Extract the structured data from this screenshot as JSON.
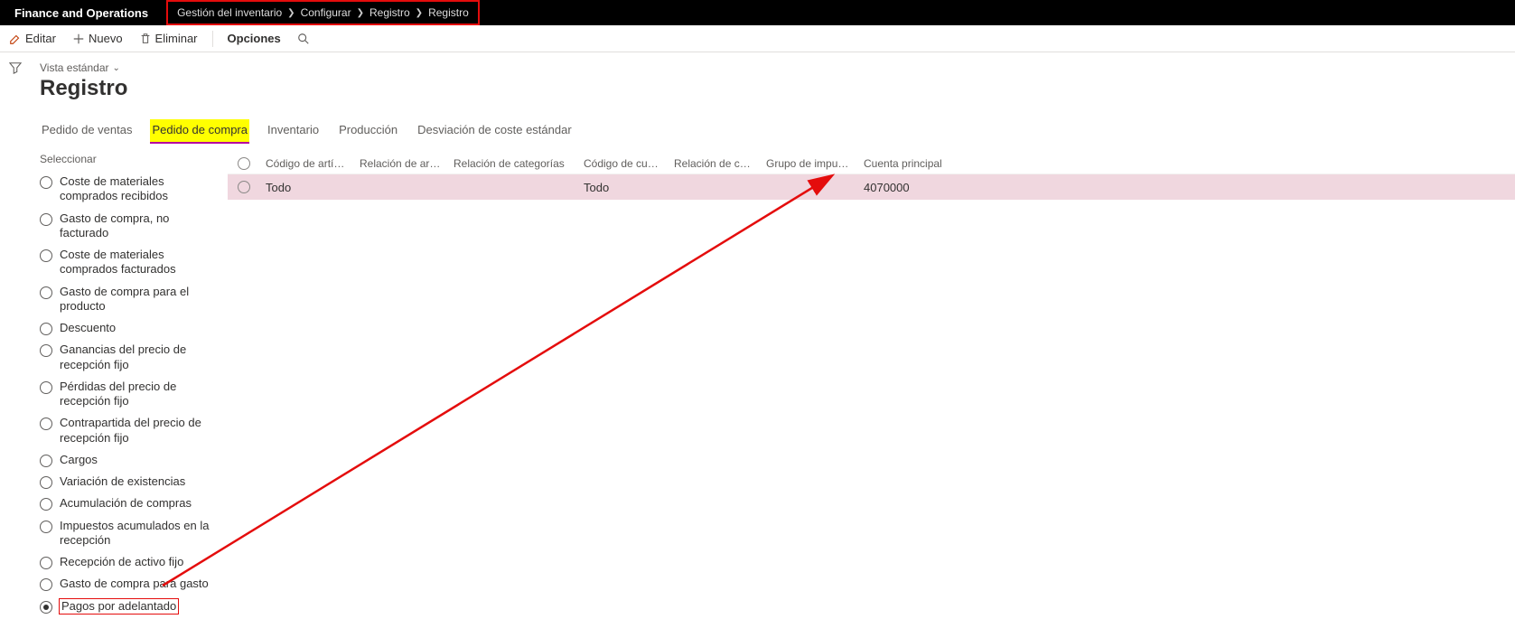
{
  "app_title": "Finance and Operations",
  "breadcrumb": [
    "Gestión del inventario",
    "Configurar",
    "Registro",
    "Registro"
  ],
  "actions": {
    "edit": "Editar",
    "new": "Nuevo",
    "delete": "Eliminar",
    "options": "Opciones"
  },
  "view_label": "Vista estándar",
  "page_title": "Registro",
  "tabs": [
    {
      "label": "Pedido de ventas",
      "active": false
    },
    {
      "label": "Pedido de compra",
      "active": true
    },
    {
      "label": "Inventario",
      "active": false
    },
    {
      "label": "Producción",
      "active": false
    },
    {
      "label": "Desviación de coste estándar",
      "active": false
    }
  ],
  "select_section_label": "Seleccionar",
  "select_options": [
    {
      "label": "Coste de materiales comprados recibidos",
      "selected": false
    },
    {
      "label": "Gasto de compra, no facturado",
      "selected": false
    },
    {
      "label": "Coste de materiales comprados facturados",
      "selected": false
    },
    {
      "label": "Gasto de compra para el producto",
      "selected": false
    },
    {
      "label": "Descuento",
      "selected": false
    },
    {
      "label": "Ganancias del precio de recepción fijo",
      "selected": false
    },
    {
      "label": "Pérdidas del precio de recepción fijo",
      "selected": false
    },
    {
      "label": "Contrapartida del precio de recepción fijo",
      "selected": false
    },
    {
      "label": "Cargos",
      "selected": false
    },
    {
      "label": "Variación de existencias",
      "selected": false
    },
    {
      "label": "Acumulación de compras",
      "selected": false
    },
    {
      "label": "Impuestos acumulados en la recepción",
      "selected": false
    },
    {
      "label": "Recepción de activo fijo",
      "selected": false
    },
    {
      "label": "Gasto de compra para gasto",
      "selected": false
    },
    {
      "label": "Pagos por adelantado",
      "selected": true
    }
  ],
  "grid": {
    "columns": {
      "codigo_articulo": "Código de artículo",
      "relacion_articulos": "Relación de artículos",
      "relacion_categorias": "Relación de categorías",
      "codigo_cuenta": "Código de cuenta",
      "relacion_cuentas": "Relación de cuentas",
      "grupo_impuestos": "Grupo de impuestos",
      "cuenta_principal": "Cuenta principal"
    },
    "rows": [
      {
        "codigo_articulo": "Todo",
        "relacion_articulos": "",
        "relacion_categorias": "",
        "codigo_cuenta": "Todo",
        "relacion_cuentas": "",
        "grupo_impuestos": "",
        "cuenta_principal": "4070000"
      }
    ]
  }
}
